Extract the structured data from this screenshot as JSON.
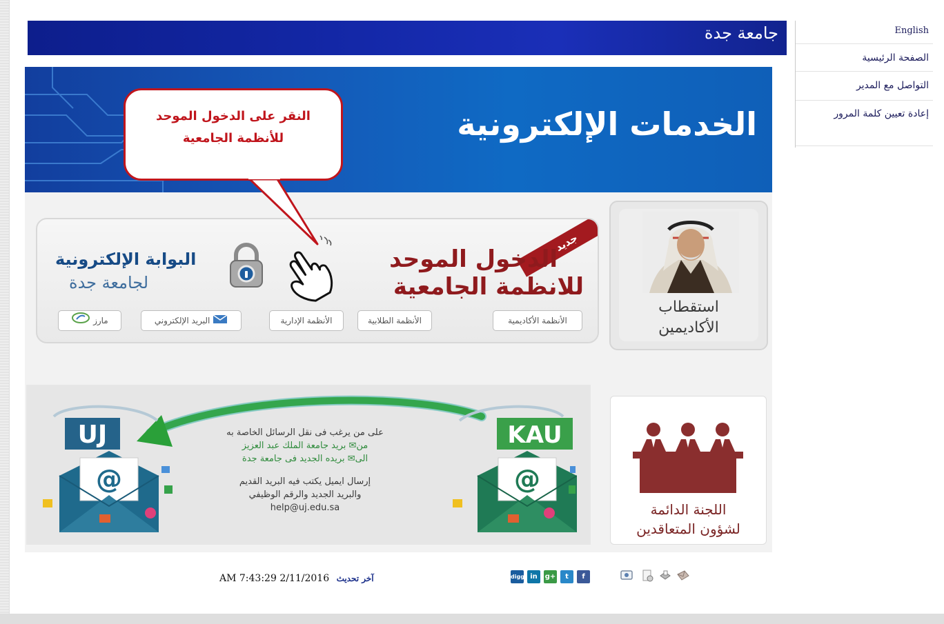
{
  "header": {
    "title": "جامعة جدة"
  },
  "sidebar": {
    "items": [
      {
        "label": "English"
      },
      {
        "label": "الصفحة الرئيسية"
      },
      {
        "label": "التواصل مع المدير"
      },
      {
        "label": "إعادة تعيين كلمة المرور"
      }
    ]
  },
  "hero": {
    "title": "الخدمات الإلكترونية"
  },
  "callout": {
    "line1": "النقر على الدخول الموحد",
    "line2": "للأنظمة الجامعية"
  },
  "portal": {
    "ribbon": "جديد",
    "sso_line1": "الدخول الموحد",
    "sso_line2": "للانظمة الجامعية",
    "portal_line1": "البوابة الإلكترونية",
    "portal_line2": "لجامعة جدة",
    "buttons": [
      {
        "label": "الأنظمة الأكاديمية"
      },
      {
        "label": "الأنظمة الطلابية"
      },
      {
        "label": "الأنظمة الإدارية"
      },
      {
        "label": "البريد الإلكتروني"
      },
      {
        "label": "مارز"
      }
    ]
  },
  "recruit": {
    "line1": "استقطاب",
    "line2": "الأكاديمين"
  },
  "email_banner": {
    "logo_from": "KAU",
    "logo_to": "UJ",
    "at_symbol": "@",
    "lines": [
      "على من يرغب فى نقل الرسائل الخاصة به",
      "من✉ بريد جامعة الملك عبد العزيز",
      "الى✉ بريده الجديد فى جامعة جدة",
      "إرسال ايميل يكتب فيه البريد القديم",
      "والبريد الجديد والرقم الوظيفي",
      "help@uj.edu.sa"
    ]
  },
  "committee": {
    "line1": "اللجنة الدائمة",
    "line2": "لشؤون المتعاقدين"
  },
  "footer": {
    "update_label": "آخر تحديث",
    "update_value": "AM 7:43:29 2/11/2016",
    "social": [
      "digg",
      "in",
      "g+",
      "t",
      "f"
    ]
  },
  "colors": {
    "header_blue": "#1327a6",
    "hero_blue": "#1558b7",
    "callout_red": "#c0151c",
    "sso_maroon": "#8f1a1d",
    "email_green": "#2f8b3c"
  }
}
